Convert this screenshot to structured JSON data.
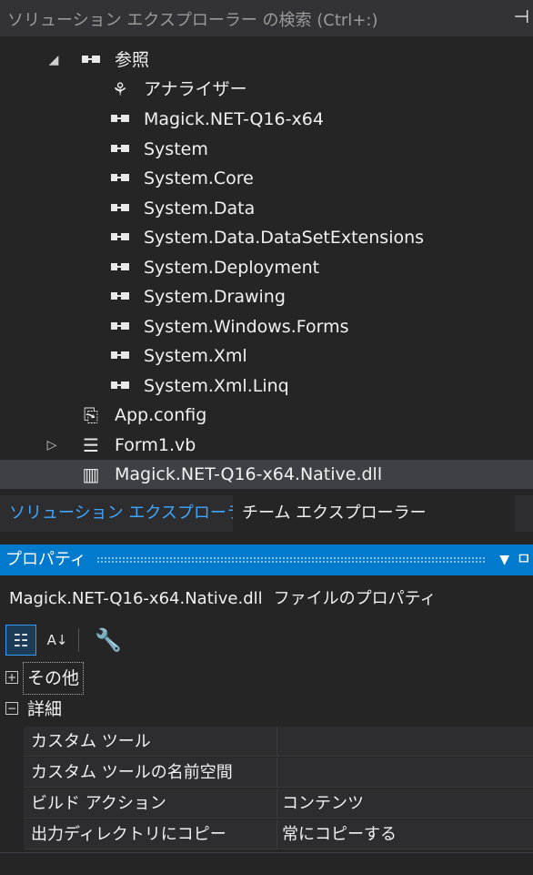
{
  "search": {
    "placeholder": "ソリューション エクスプローラー の検索 (Ctrl+:)"
  },
  "tree": {
    "references_label": "参照",
    "analyzers_label": "アナライザー",
    "references": [
      "Magick.NET-Q16-x64",
      "System",
      "System.Core",
      "System.Data",
      "System.Data.DataSetExtensions",
      "System.Deployment",
      "System.Drawing",
      "System.Windows.Forms",
      "System.Xml",
      "System.Xml.Linq"
    ],
    "app_config": "App.config",
    "form1": "Form1.vb",
    "native_dll": "Magick.NET-Q16-x64.Native.dll"
  },
  "tabs": {
    "solution_explorer": "ソリューション エクスプローラー",
    "team_explorer": "チーム エクスプローラー"
  },
  "properties": {
    "title": "プロパティ",
    "object_name": "Magick.NET-Q16-x64.Native.dll",
    "object_kind": "ファイルのプロパティ",
    "categories": {
      "misc": "その他",
      "advanced": "詳細"
    },
    "rows": [
      {
        "name": "カスタム ツール",
        "value": ""
      },
      {
        "name": "カスタム ツールの名前空間",
        "value": ""
      },
      {
        "name": "ビルド アクション",
        "value": "コンテンツ"
      },
      {
        "name": "出力ディレクトリにコピー",
        "value": "常にコピーする"
      }
    ]
  },
  "colors": {
    "accent": "#007acc",
    "active_tab": "#3ea6ff",
    "background": "#252526"
  }
}
